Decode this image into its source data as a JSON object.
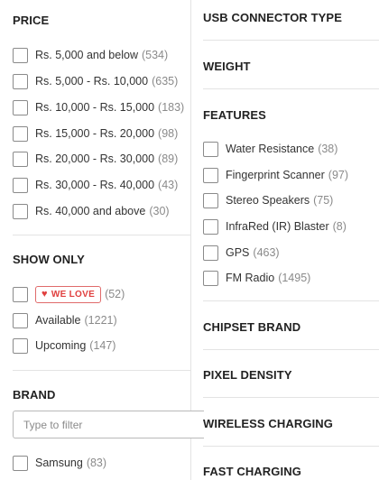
{
  "price": {
    "title": "PRICE",
    "items": [
      {
        "label": "Rs. 5,000 and below",
        "count": "(534)"
      },
      {
        "label": "Rs. 5,000 - Rs. 10,000",
        "count": "(635)"
      },
      {
        "label": "Rs. 10,000 - Rs. 15,000",
        "count": "(183)"
      },
      {
        "label": "Rs. 15,000 - Rs. 20,000",
        "count": "(98)"
      },
      {
        "label": "Rs. 20,000 - Rs. 30,000",
        "count": "(89)"
      },
      {
        "label": "Rs. 30,000 - Rs. 40,000",
        "count": "(43)"
      },
      {
        "label": "Rs. 40,000 and above",
        "count": "(30)"
      }
    ]
  },
  "show_only": {
    "title": "SHOW ONLY",
    "we_love": {
      "heart": "♥",
      "label": "WE LOVE",
      "count": "(52)"
    },
    "items": [
      {
        "label": "Available",
        "count": "(1221)"
      },
      {
        "label": "Upcoming",
        "count": "(147)"
      }
    ]
  },
  "brand": {
    "title": "BRAND",
    "filter_placeholder": "Type to filter",
    "items": [
      {
        "label": "Samsung",
        "count": "(83)"
      }
    ]
  },
  "usb_connector": {
    "title": "USB CONNECTOR TYPE"
  },
  "weight": {
    "title": "WEIGHT"
  },
  "features": {
    "title": "FEATURES",
    "items": [
      {
        "label": "Water Resistance",
        "count": "(38)"
      },
      {
        "label": "Fingerprint Scanner",
        "count": "(97)"
      },
      {
        "label": "Stereo Speakers",
        "count": "(75)"
      },
      {
        "label": "InfraRed (IR) Blaster",
        "count": "(8)"
      },
      {
        "label": "GPS",
        "count": "(463)"
      },
      {
        "label": "FM Radio",
        "count": "(1495)"
      }
    ]
  },
  "chipset_brand": {
    "title": "CHIPSET BRAND"
  },
  "pixel_density": {
    "title": "PIXEL DENSITY"
  },
  "wireless_charging": {
    "title": "WIRELESS CHARGING"
  },
  "fast_charging": {
    "title": "FAST CHARGING"
  },
  "colors": {
    "accent": "#e0403f",
    "border": "#e3e3e3",
    "muted": "#8a8a8a"
  }
}
